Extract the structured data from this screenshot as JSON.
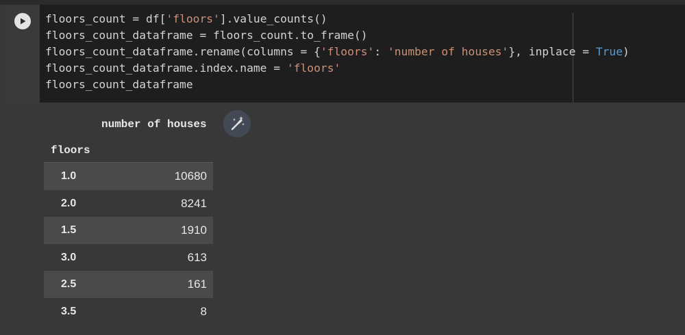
{
  "cell": {
    "run_button_label": "Run cell",
    "code_lines": [
      [
        {
          "t": "floors_count = df["
        },
        {
          "t": "'floors'",
          "c": "str"
        },
        {
          "t": "].value_counts()"
        }
      ],
      [
        {
          "t": "floors_count_dataframe = floors_count.to_frame()"
        }
      ],
      [
        {
          "t": "floors_count_dataframe.rename(columns = {"
        },
        {
          "t": "'floors'",
          "c": "str"
        },
        {
          "t": ": "
        },
        {
          "t": "'number of houses'",
          "c": "str"
        },
        {
          "t": "}, inplace = "
        },
        {
          "t": "True",
          "c": "kw"
        },
        {
          "t": ")"
        }
      ],
      [
        {
          "t": "floors_count_dataframe.index.name = "
        },
        {
          "t": "'floors'",
          "c": "str"
        }
      ],
      [
        {
          "t": "floors_count_dataframe"
        }
      ]
    ]
  },
  "output": {
    "column_header": "number of houses",
    "index_name": "floors",
    "rows": [
      {
        "index": "1.0",
        "value": "10680"
      },
      {
        "index": "2.0",
        "value": "8241"
      },
      {
        "index": "1.5",
        "value": "1910"
      },
      {
        "index": "3.0",
        "value": "613"
      },
      {
        "index": "2.5",
        "value": "161"
      },
      {
        "index": "3.5",
        "value": "8"
      }
    ],
    "wand_icon": "magic-wand-icon"
  }
}
